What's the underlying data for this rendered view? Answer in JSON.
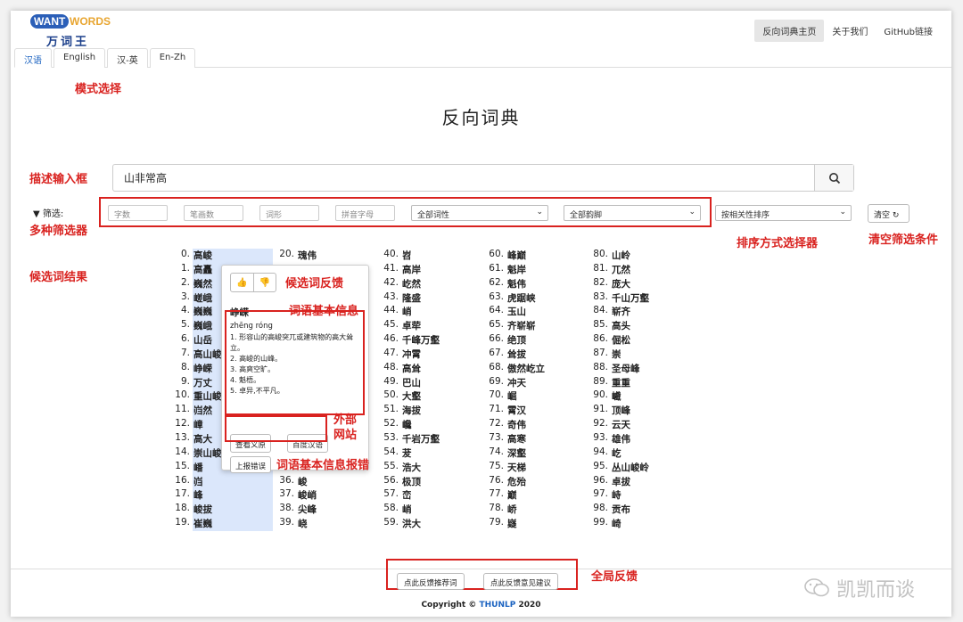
{
  "header": {
    "logo": {
      "want": "WANT",
      "words": "WORDS",
      "cn": "万词王"
    },
    "nav": [
      "反向词典主页",
      "关于我们",
      "GitHub链接"
    ]
  },
  "tabs": [
    "汉语",
    "English",
    "汉-英",
    "En-Zh"
  ],
  "title": "反向词典",
  "search": {
    "value": "山非常高"
  },
  "filter": {
    "label": "筛选:",
    "inputs": [
      "字数",
      "笔画数",
      "词形",
      "拼音字母"
    ],
    "pos_select": "全部词性",
    "rhyme_select": "全部韵脚",
    "sort_select": "按相关性排序",
    "clear": "清空"
  },
  "annotations": {
    "mode": "模式选择",
    "input": "描述输入框",
    "filters": "多种筛选器",
    "results": "候选词结果",
    "sorter": "排序方式选择器",
    "clear": "清空筛选条件",
    "feedback": "候选词反馈",
    "basic_info": "词语基本信息",
    "external": "外部\n网站",
    "report": "词语基本信息报错",
    "global": "全局反馈"
  },
  "results": [
    [
      "0.",
      "高峻"
    ],
    [
      "1.",
      "高矗"
    ],
    [
      "2.",
      "巍然"
    ],
    [
      "3.",
      "嵯峨"
    ],
    [
      "4.",
      "巍巍"
    ],
    [
      "5.",
      "巍峨"
    ],
    [
      "6.",
      "山岳"
    ],
    [
      "7.",
      "高山峻"
    ],
    [
      "8.",
      "峥嵘"
    ],
    [
      "9.",
      "万丈"
    ],
    [
      "10.",
      "重山峻"
    ],
    [
      "11.",
      "岿然"
    ],
    [
      "12.",
      "嶂"
    ],
    [
      "13.",
      "高大"
    ],
    [
      "14.",
      "崇山峻"
    ],
    [
      "15.",
      "嶓"
    ],
    [
      "16.",
      "岿"
    ],
    [
      "17.",
      "峰"
    ],
    [
      "18.",
      "峻拔"
    ],
    [
      "19.",
      "崔巍"
    ],
    [
      "20.",
      "瑰伟"
    ],
    [
      "36.",
      "峻"
    ],
    [
      "37.",
      "峻峭"
    ],
    [
      "38.",
      "尖峰"
    ],
    [
      "39.",
      "峣"
    ],
    [
      "40.",
      "岧"
    ],
    [
      "41.",
      "高岸"
    ],
    [
      "42.",
      "屹然"
    ],
    [
      "43.",
      "隆盛"
    ],
    [
      "44.",
      "峭"
    ],
    [
      "45.",
      "卓荦"
    ],
    [
      "46.",
      "千峰万壑"
    ],
    [
      "47.",
      "冲霄"
    ],
    [
      "48.",
      "高耸"
    ],
    [
      "49.",
      "巴山"
    ],
    [
      "50.",
      "大壑"
    ],
    [
      "51.",
      "海拔"
    ],
    [
      "52.",
      "巉"
    ],
    [
      "53.",
      "千岩万壑"
    ],
    [
      "54.",
      "茇"
    ],
    [
      "55.",
      "浩大"
    ],
    [
      "56.",
      "极顶"
    ],
    [
      "57.",
      "峦"
    ],
    [
      "58.",
      "峭"
    ],
    [
      "59.",
      "洪大"
    ],
    [
      "60.",
      "峰巅"
    ],
    [
      "61.",
      "魁岸"
    ],
    [
      "62.",
      "魁伟"
    ],
    [
      "63.",
      "虎踞峡"
    ],
    [
      "64.",
      "玉山"
    ],
    [
      "65.",
      "齐崭崭"
    ],
    [
      "66.",
      "绝顶"
    ],
    [
      "67.",
      "耸拔"
    ],
    [
      "68.",
      "傲然屹立"
    ],
    [
      "69.",
      "冲天"
    ],
    [
      "70.",
      "崛"
    ],
    [
      "71.",
      "霄汉"
    ],
    [
      "72.",
      "奇伟"
    ],
    [
      "73.",
      "高寒"
    ],
    [
      "74.",
      "深壑"
    ],
    [
      "75.",
      "天梯"
    ],
    [
      "76.",
      "危殆"
    ],
    [
      "77.",
      "巅"
    ],
    [
      "78.",
      "峤"
    ],
    [
      "79.",
      "嶷"
    ],
    [
      "80.",
      "山岭"
    ],
    [
      "81.",
      "兀然"
    ],
    [
      "82.",
      "庞大"
    ],
    [
      "83.",
      "千山万壑"
    ],
    [
      "84.",
      "崭齐"
    ],
    [
      "85.",
      "高头"
    ],
    [
      "86.",
      "倔松"
    ],
    [
      "87.",
      "崇"
    ],
    [
      "88.",
      "圣母峰"
    ],
    [
      "89.",
      "重重"
    ],
    [
      "90.",
      "巇"
    ],
    [
      "91.",
      "顶峰"
    ],
    [
      "92.",
      "云天"
    ],
    [
      "93.",
      "雄伟"
    ],
    [
      "94.",
      "屹"
    ],
    [
      "95.",
      "丛山峻岭"
    ],
    [
      "96.",
      "卓拔"
    ],
    [
      "97.",
      "峙"
    ],
    [
      "98.",
      "贡布"
    ],
    [
      "99.",
      "崎"
    ]
  ],
  "popup": {
    "word": "峥嵘",
    "pinyin": "zhēng róng",
    "defs": [
      "1. 形容山的高峻突兀或建筑物的高大耸立。",
      "2. 高峻的山峰。",
      "3. 高爽空旷。",
      "4. 魁梧。",
      "5. 卓异,不平凡。"
    ],
    "btn_yuan": "查看义原",
    "btn_baidu": "百度汉语",
    "btn_report": "上报错误"
  },
  "footer": {
    "btn_recommend": "点此反馈推荐词",
    "btn_suggest": "点此反馈意见建议",
    "copyright": "Copyright ©",
    "org": "THUNLP",
    "year": "2020"
  },
  "watermark": "凯凯而谈"
}
